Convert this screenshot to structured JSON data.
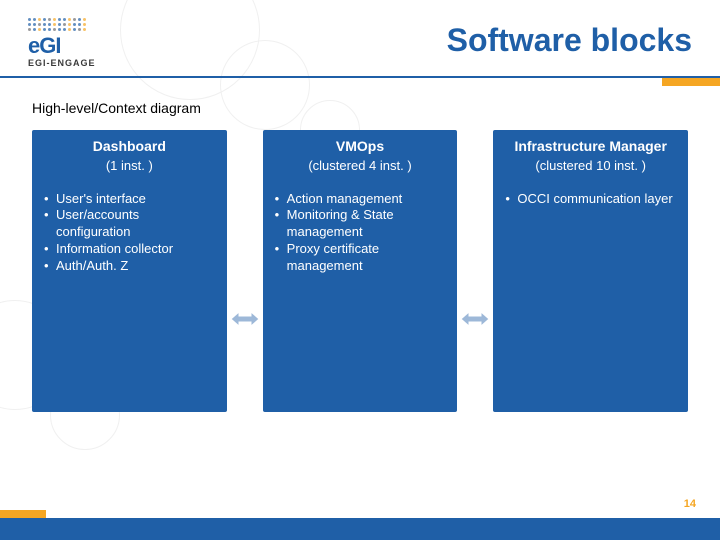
{
  "brand": {
    "name": "eGI",
    "tagline": "EGI-ENGAGE"
  },
  "title": "Software blocks",
  "subtitle": "High-level/Context diagram",
  "blocks": [
    {
      "heading": "Dashboard",
      "sub": "(1 inst. )",
      "items": [
        "User's interface",
        "User/accounts configuration",
        "Information collector",
        "Auth/Auth. Z"
      ]
    },
    {
      "heading": "VMOps",
      "sub": "(clustered 4 inst. )",
      "items": [
        "Action management",
        "Monitoring & State management",
        "Proxy certificate management"
      ]
    },
    {
      "heading": "Infrastructure Manager",
      "sub": "(clustered 10 inst. )",
      "items": [
        "OCCI communication layer"
      ]
    }
  ],
  "page_number": "14"
}
